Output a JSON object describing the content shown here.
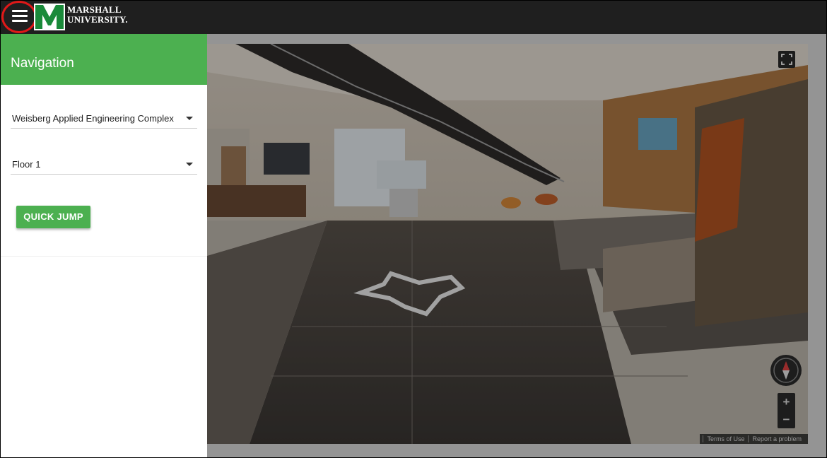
{
  "header": {
    "logo_line1": "MARSHALL",
    "logo_line2": "UNIVERSITY."
  },
  "navigation": {
    "title": "Navigation",
    "building_select": {
      "value": "Weisberg Applied Engineering Complex"
    },
    "floor_select": {
      "value": "Floor 1"
    },
    "quick_jump_label": "QUICK JUMP"
  },
  "viewer": {
    "footer": {
      "terms": "Terms of Use",
      "report": "Report a problem"
    }
  },
  "colors": {
    "accent_green": "#4cb050",
    "topbar": "#1f1f1f",
    "menu_highlight": "#e01818"
  }
}
